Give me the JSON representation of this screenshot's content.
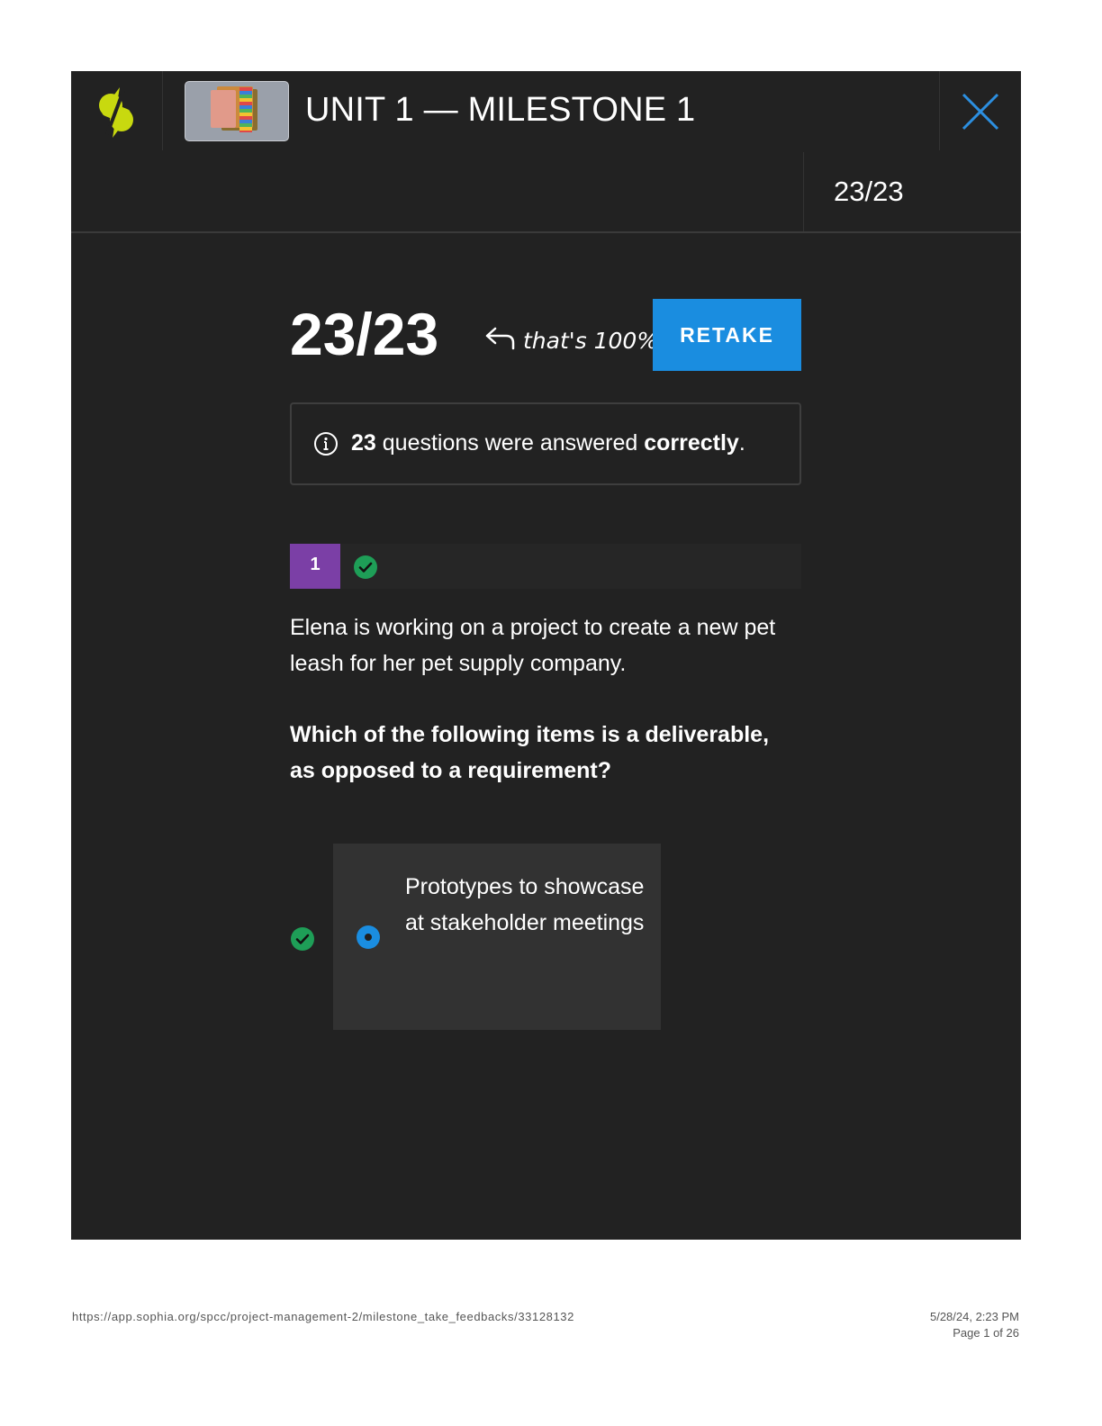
{
  "header": {
    "logo": "sophia-logo",
    "unit_title": "UNIT 1 — MILESTONE 1",
    "close_icon": "close-icon",
    "score": "23/23"
  },
  "results": {
    "score": "23/23",
    "note": "that's 100%",
    "retake_label": "RETAKE",
    "info_count": "23",
    "info_text_middle": " questions were answered ",
    "info_text_bold": "correctly",
    "info_text_end": "."
  },
  "question": {
    "number": "1",
    "status": "correct",
    "body": "Elena is working on a project to create a new pet leash for her pet supply company.",
    "prompt": "Which of the following items is a deliverable, as opposed to a requirement?",
    "answer_text": "Prototypes to showcase at stakeholder meetings",
    "answer_status": "correct"
  },
  "footer": {
    "url": "https://app.sophia.org/spcc/project-management-2/milestone_take_feedbacks/33128132",
    "datetime": "5/28/24, 2:23 PM",
    "page": "Page 1 of 26"
  },
  "colors": {
    "background": "#222222",
    "accent_blue": "#1a8de0",
    "question_purple": "#7b3fa6",
    "correct_green": "#1e9e57",
    "logo_lime": "#c8d90f"
  }
}
